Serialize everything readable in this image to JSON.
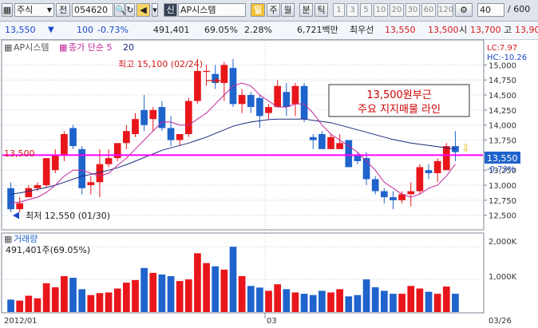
{
  "toolbar": {
    "market": "주식",
    "market_prefix": "전",
    "code": "054620",
    "name": "AP시스템",
    "flag": "신",
    "unit_btn": "일",
    "week_btn": "주",
    "month_btn": "월",
    "minute_btn": "분",
    "tick_btn": "틱",
    "periods": [
      "1",
      "3",
      "5",
      "10",
      "20",
      "30",
      "60",
      "120"
    ],
    "count": "40",
    "total": "/ 600"
  },
  "quote": {
    "price": "13,550",
    "change": "100",
    "change_pct": "-0.73%",
    "volume": "491,401",
    "vol_ratio": "69.05%",
    "turnover": "2.28%",
    "amount": "6,721백만",
    "best_bid_label": "최우선",
    "bid": "13,550",
    "ask": "13,500",
    "open_label": "시",
    "open": "13,700",
    "high_label": "고",
    "high": "13,90"
  },
  "legend": {
    "name": "AP시스템",
    "ma_label": "종가 단순 5",
    "ma2": "20",
    "lc": "LC:7.97",
    "hc": "HC:-10.26"
  },
  "annotations": {
    "max_label": "최고 15,100 (02/24)",
    "min_label": "최저 12,550 (01/30)",
    "support_price": "13,500",
    "box_line1": "13,500원부근",
    "box_line2": "주요 지지매물 라인",
    "cur_price": "13,550",
    "cur_pct": "-0.73%"
  },
  "volume_panel": {
    "title": "거래량",
    "value": "491,401주(69.05%)"
  },
  "x_axis": {
    "labels": [
      "2012/01",
      "03",
      "03/26"
    ]
  },
  "colors": {
    "up": "#e8161b",
    "down": "#1f63cc",
    "ma5": "#c0289a",
    "ma20": "#1b2a7a",
    "support": "#ff00ff"
  },
  "chart_data": {
    "type": "candlestick",
    "y_ticks": [
      "15,000",
      "14,750",
      "14,500",
      "14,250",
      "14,000",
      "13,750",
      "13,550",
      "13,250",
      "13,000",
      "12,750",
      "12,500"
    ],
    "y_range": [
      12350,
      15350
    ],
    "volume_ticks": [
      "2,000K",
      "1,000K"
    ],
    "volume_range": [
      0,
      2200
    ],
    "support_line": 13500,
    "candles": [
      {
        "o": 12950,
        "h": 13050,
        "l": 12550,
        "c": 12600
      },
      {
        "o": 12600,
        "h": 12800,
        "l": 12550,
        "c": 12700
      },
      {
        "o": 12800,
        "h": 13000,
        "l": 12800,
        "c": 12950
      },
      {
        "o": 12950,
        "h": 13050,
        "l": 12900,
        "c": 13000
      },
      {
        "o": 13000,
        "h": 13450,
        "l": 12950,
        "c": 13450
      },
      {
        "o": 13250,
        "h": 13600,
        "l": 13200,
        "c": 13500
      },
      {
        "o": 13500,
        "h": 13900,
        "l": 13400,
        "c": 13850
      },
      {
        "o": 13950,
        "h": 14000,
        "l": 13600,
        "c": 13650
      },
      {
        "o": 13600,
        "h": 13650,
        "l": 12850,
        "c": 12950
      },
      {
        "o": 13000,
        "h": 13150,
        "l": 12850,
        "c": 13050
      },
      {
        "o": 13050,
        "h": 13600,
        "l": 12800,
        "c": 13350
      },
      {
        "o": 13350,
        "h": 13600,
        "l": 13300,
        "c": 13450
      },
      {
        "o": 13450,
        "h": 13650,
        "l": 13400,
        "c": 13700
      },
      {
        "o": 13700,
        "h": 14000,
        "l": 13600,
        "c": 13900
      },
      {
        "o": 13850,
        "h": 14200,
        "l": 13800,
        "c": 14100
      },
      {
        "o": 14250,
        "h": 14500,
        "l": 13900,
        "c": 14000
      },
      {
        "o": 14100,
        "h": 14300,
        "l": 13900,
        "c": 14250
      },
      {
        "o": 14300,
        "h": 14400,
        "l": 13900,
        "c": 13950
      },
      {
        "o": 13950,
        "h": 14150,
        "l": 13650,
        "c": 13750
      },
      {
        "o": 13750,
        "h": 13850,
        "l": 13650,
        "c": 13850
      },
      {
        "o": 13850,
        "h": 14450,
        "l": 13800,
        "c": 14400
      },
      {
        "o": 14400,
        "h": 15100,
        "l": 14350,
        "c": 14900
      },
      {
        "o": 14900,
        "h": 15000,
        "l": 14650,
        "c": 14900
      },
      {
        "o": 14850,
        "h": 15000,
        "l": 14600,
        "c": 14700
      },
      {
        "o": 14700,
        "h": 15050,
        "l": 14400,
        "c": 15000
      },
      {
        "o": 14950,
        "h": 15100,
        "l": 14300,
        "c": 14350
      },
      {
        "o": 14350,
        "h": 14600,
        "l": 14200,
        "c": 14500
      },
      {
        "o": 14500,
        "h": 14550,
        "l": 14200,
        "c": 14300
      },
      {
        "o": 14450,
        "h": 14500,
        "l": 13950,
        "c": 14150
      },
      {
        "o": 14200,
        "h": 14350,
        "l": 14100,
        "c": 14300
      },
      {
        "o": 14300,
        "h": 14750,
        "l": 14300,
        "c": 14650
      },
      {
        "o": 14550,
        "h": 14700,
        "l": 14150,
        "c": 14300
      },
      {
        "o": 14350,
        "h": 14700,
        "l": 14150,
        "c": 14650
      },
      {
        "o": 14650,
        "h": 14700,
        "l": 14050,
        "c": 14100
      },
      {
        "o": 13800,
        "h": 13850,
        "l": 13600,
        "c": 13750
      },
      {
        "o": 13850,
        "h": 13900,
        "l": 13600,
        "c": 13600
      },
      {
        "o": 13600,
        "h": 13850,
        "l": 13600,
        "c": 13800
      },
      {
        "o": 13600,
        "h": 13850,
        "l": 13650,
        "c": 13700
      },
      {
        "o": 13750,
        "h": 13750,
        "l": 13300,
        "c": 13300
      },
      {
        "o": 13500,
        "h": 13550,
        "l": 13350,
        "c": 13400
      },
      {
        "o": 13450,
        "h": 13550,
        "l": 13000,
        "c": 13100
      },
      {
        "o": 13100,
        "h": 13150,
        "l": 12850,
        "c": 12900
      },
      {
        "o": 12900,
        "h": 12950,
        "l": 12700,
        "c": 12800
      },
      {
        "o": 12800,
        "h": 12900,
        "l": 12600,
        "c": 12750
      },
      {
        "o": 12750,
        "h": 12900,
        "l": 12700,
        "c": 12850
      },
      {
        "o": 12850,
        "h": 13050,
        "l": 12650,
        "c": 12900
      },
      {
        "o": 12900,
        "h": 13350,
        "l": 12850,
        "c": 13300
      },
      {
        "o": 13250,
        "h": 13350,
        "l": 13100,
        "c": 13200
      },
      {
        "o": 13200,
        "h": 13450,
        "l": 13050,
        "c": 13400
      },
      {
        "o": 13250,
        "h": 13700,
        "l": 13250,
        "c": 13650
      },
      {
        "o": 13650,
        "h": 13900,
        "l": 13400,
        "c": 13550
      }
    ],
    "ma5": [
      12700,
      12720,
      12760,
      12800,
      12880,
      13000,
      13150,
      13250,
      13250,
      13200,
      13150,
      13200,
      13330,
      13450,
      13600,
      13750,
      13900,
      14050,
      14050,
      14000,
      14000,
      14100,
      14200,
      14350,
      14500,
      14650,
      14700,
      14650,
      14500,
      14400,
      14300,
      14300,
      14350,
      14350,
      14200,
      14000,
      13850,
      13750,
      13650,
      13550,
      13400,
      13250,
      13050,
      12950,
      12850,
      12800,
      12850,
      12950,
      13000,
      13150,
      13350
    ],
    "ma20": [
      12850,
      12870,
      12900,
      12930,
      12960,
      13000,
      13050,
      13100,
      13150,
      13180,
      13210,
      13250,
      13290,
      13340,
      13400,
      13460,
      13520,
      13580,
      13620,
      13660,
      13700,
      13750,
      13800,
      13860,
      13920,
      13980,
      14020,
      14050,
      14070,
      14090,
      14100,
      14100,
      14100,
      14100,
      14080,
      14060,
      14040,
      14000,
      13960,
      13920,
      13880,
      13840,
      13800,
      13760,
      13730,
      13700,
      13680,
      13660,
      13640,
      13620,
      13600
    ],
    "volume": [
      380,
      350,
      500,
      420,
      880,
      760,
      1100,
      1050,
      700,
      520,
      580,
      600,
      720,
      900,
      980,
      1350,
      1200,
      1150,
      1100,
      950,
      1000,
      1800,
      1500,
      1400,
      1300,
      2000,
      1100,
      800,
      750,
      650,
      850,
      700,
      600,
      560,
      520,
      650,
      600,
      700,
      480,
      520,
      1000,
      760,
      650,
      560,
      560,
      800,
      720,
      620,
      560,
      780,
      560
    ]
  }
}
